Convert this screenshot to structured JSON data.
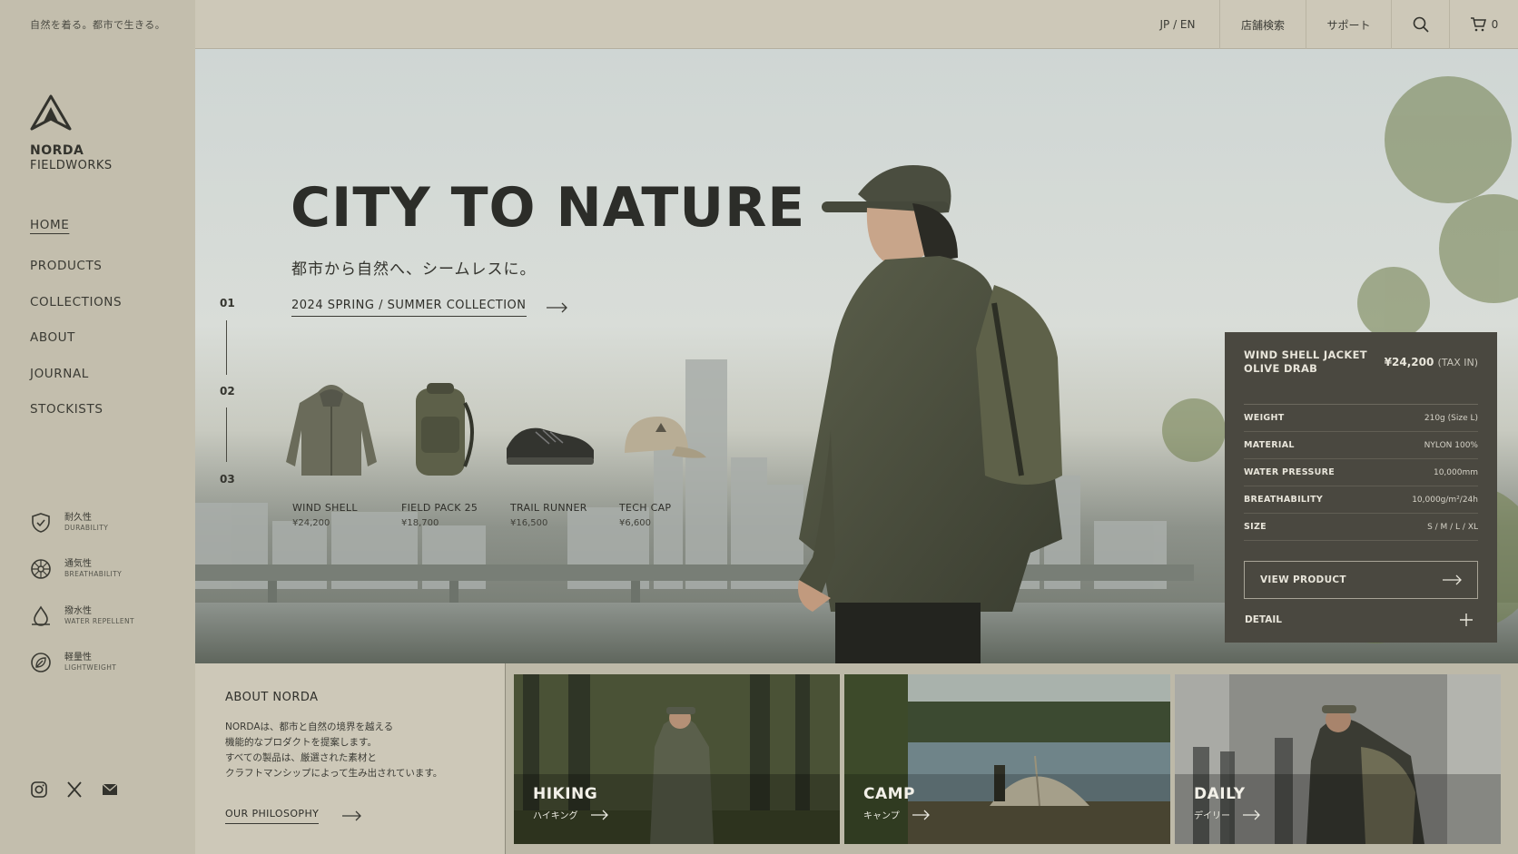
{
  "topbar": {
    "tagline": "自然を着る。都市で生きる。",
    "lang": "JP / EN",
    "store_search": "店舗検索",
    "support": "サポート",
    "cart_count": "0"
  },
  "brand": {
    "name": "NORDA",
    "sub": "FIELDWORKS"
  },
  "menu": [
    {
      "label": "HOME",
      "active": true
    },
    {
      "label": "PRODUCTS"
    },
    {
      "label": "COLLECTIONS"
    },
    {
      "label": "ABOUT"
    },
    {
      "label": "JOURNAL"
    },
    {
      "label": "STOCKISTS"
    }
  ],
  "features": [
    {
      "jp": "耐久性",
      "en": "DURABILITY",
      "icon": "shield-check-icon"
    },
    {
      "jp": "通気性",
      "en": "BREATHABILITY",
      "icon": "air-circle-icon"
    },
    {
      "jp": "撥水性",
      "en": "WATER REPELLENT",
      "icon": "water-drop-icon"
    },
    {
      "jp": "軽量性",
      "en": "LIGHTWEIGHT",
      "icon": "leaf-circle-icon"
    }
  ],
  "social": [
    "instagram-icon",
    "x-icon",
    "mail-icon"
  ],
  "hero": {
    "title": "CITY TO NATURE",
    "subtitle": "都市から自然へ、シームレスに。",
    "collection_link": "2024 SPRING / SUMMER COLLECTION",
    "pager": [
      "01",
      "02",
      "03"
    ]
  },
  "products": [
    {
      "name": "WIND SHELL",
      "price": "¥24,200"
    },
    {
      "name": "FIELD PACK 25",
      "price": "¥18,700"
    },
    {
      "name": "TRAIL RUNNER",
      "price": "¥16,500"
    },
    {
      "name": "TECH CAP",
      "price": "¥6,600"
    }
  ],
  "spec": {
    "name_line1": "WIND SHELL JACKET",
    "name_line2": "OLIVE DRAB",
    "price": "¥24,200",
    "tax": "(TAX IN)",
    "rows": [
      {
        "k": "WEIGHT",
        "v": "210g (Size L)"
      },
      {
        "k": "MATERIAL",
        "v": "NYLON 100%"
      },
      {
        "k": "WATER PRESSURE",
        "v": "10,000mm"
      },
      {
        "k": "BREATHABILITY",
        "v": "10,000g/m²/24h"
      },
      {
        "k": "SIZE",
        "v": "S / M / L / XL"
      }
    ],
    "view_product": "VIEW PRODUCT",
    "detail": "DETAIL"
  },
  "about": {
    "title": "ABOUT NORDA",
    "lines": [
      "NORDAは、都市と自然の境界を越える",
      "機能的なプロダクトを提案します。",
      "すべての製品は、厳選された素材と",
      "クラフトマンシップによって生み出されています。"
    ],
    "philosophy": "OUR PHILOSOPHY"
  },
  "tiles": [
    {
      "name": "HIKING",
      "jp": "ハイキング"
    },
    {
      "name": "CAMP",
      "jp": "キャンプ"
    },
    {
      "name": "DAILY",
      "jp": "デイリー"
    }
  ],
  "colors": {
    "olive": "#4a4840",
    "sand": "#c3bead",
    "ink": "#2c2d29"
  }
}
